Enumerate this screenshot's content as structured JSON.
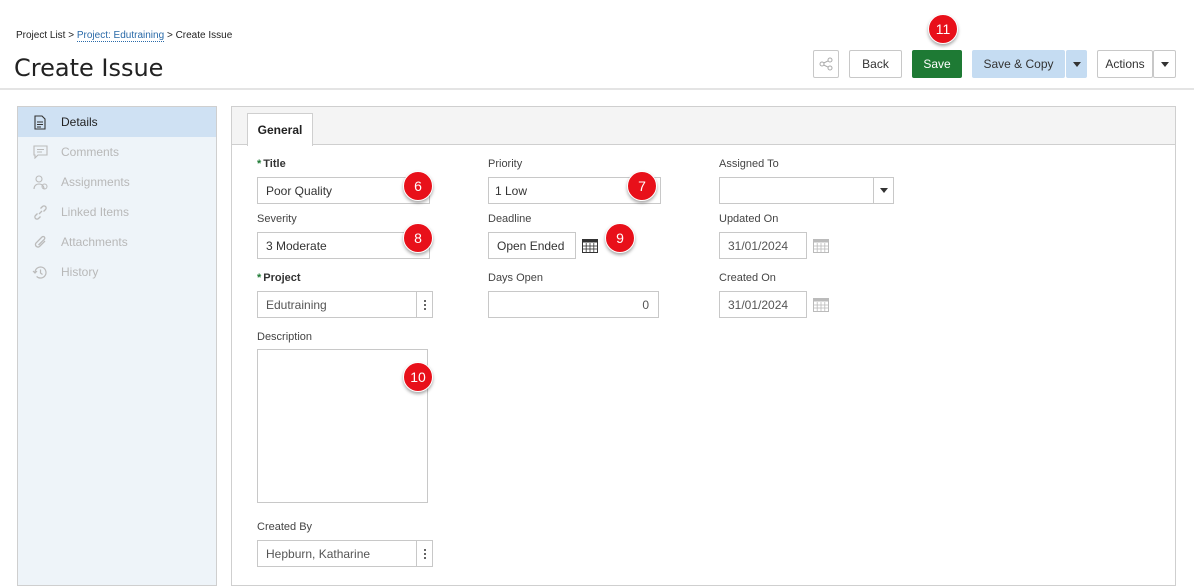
{
  "breadcrumb": {
    "project_list": "Project List",
    "sep1": ">",
    "project": "Project: Edutraining",
    "sep2": ">",
    "current": "Create Issue"
  },
  "page_title": "Create Issue",
  "toolbar": {
    "back_label": "Back",
    "save_label": "Save",
    "save_copy_label": "Save & Copy",
    "actions_label": "Actions"
  },
  "sidebar": {
    "items": [
      {
        "label": "Details",
        "icon": "document-icon"
      },
      {
        "label": "Comments",
        "icon": "comment-icon"
      },
      {
        "label": "Assignments",
        "icon": "user-icon"
      },
      {
        "label": "Linked Items",
        "icon": "link-icon"
      },
      {
        "label": "Attachments",
        "icon": "paperclip-icon"
      },
      {
        "label": "History",
        "icon": "history-icon"
      }
    ]
  },
  "tabs": {
    "general": "General"
  },
  "form": {
    "title": {
      "label": "Title",
      "value": "Poor Quality"
    },
    "priority": {
      "label": "Priority",
      "value": "1 Low"
    },
    "assigned_to": {
      "label": "Assigned To",
      "value": ""
    },
    "severity": {
      "label": "Severity",
      "value": "3 Moderate"
    },
    "deadline": {
      "label": "Deadline",
      "value": "Open Ended"
    },
    "updated_on": {
      "label": "Updated On",
      "value": "31/01/2024"
    },
    "project": {
      "label": "Project",
      "value": "Edutraining"
    },
    "days_open": {
      "label": "Days Open",
      "value": "0"
    },
    "created_on": {
      "label": "Created On",
      "value": "31/01/2024"
    },
    "description": {
      "label": "Description",
      "value": ""
    },
    "created_by": {
      "label": "Created By",
      "value": "Hepburn, Katharine"
    }
  },
  "markers": {
    "m6": "6",
    "m7": "7",
    "m8": "8",
    "m9": "9",
    "m10": "10",
    "m11": "11"
  },
  "colors": {
    "save": "#1e7a34",
    "save_copy": "#c5dcf2",
    "sidebar_active": "#cfe1f3",
    "marker": "#e8101a",
    "link": "#2a6aa8"
  }
}
